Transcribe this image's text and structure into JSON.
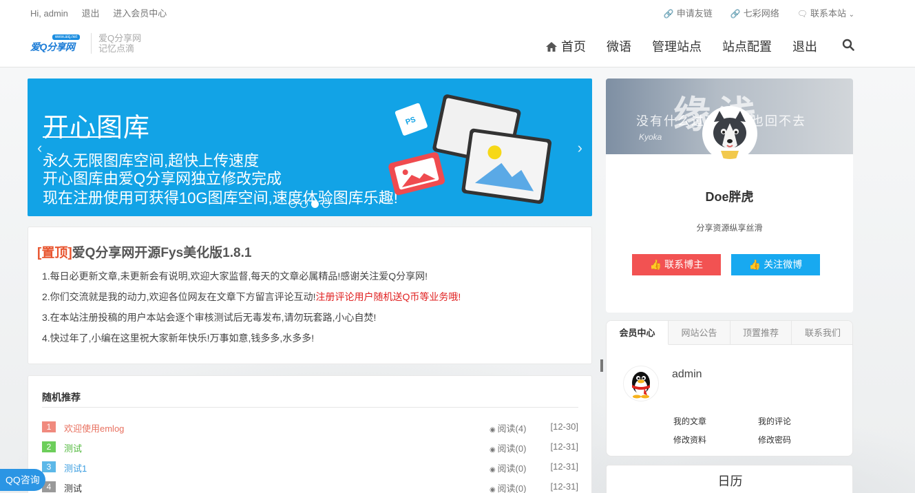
{
  "topbar": {
    "greeting": "Hi, admin",
    "logout": "退出",
    "member_center": "进入会员中心",
    "links": [
      {
        "icon": "link-icon",
        "label": "申请友链"
      },
      {
        "icon": "link-icon",
        "label": "七彩网络"
      },
      {
        "icon": "chat-icon",
        "label": "联系本站"
      }
    ]
  },
  "header": {
    "logo_text": "爱Q分享网",
    "logo_tag": "www.aiq.net",
    "slogan_line1": "爱Q分享网",
    "slogan_line2": "记忆点滴",
    "nav": [
      {
        "label": "首页",
        "icon": "home-icon"
      },
      {
        "label": "微语"
      },
      {
        "label": "管理站点"
      },
      {
        "label": "站点配置"
      },
      {
        "label": "退出"
      }
    ]
  },
  "banner": {
    "title": "开心图库",
    "lines": [
      "永久无限图库空间,超快上传速度",
      "开心图库由爱Q分享网独立修改完成",
      "现在注册使用可获得10G图库空间,速度体验图库乐趣!"
    ],
    "ps_badge": "PS",
    "active_slide": 3,
    "slide_count": 4
  },
  "post": {
    "top_tag": "[置顶]",
    "title": "爱Q分享网开源Fys美化版1.8.1",
    "para1": "1.每日必更新文章,未更新会有说明,欢迎大家监督,每天的文章必属精品!感谢关注爱Q分享网!",
    "para2_black": "2.你们交流就是我的动力,欢迎各位网友在文章下方留言评论互动!",
    "para2_red": "注册评论用户随机送Q币等业务哦!",
    "para3": "3.在本站注册投稿的用户本站会逐个审核测试后无毒发布,请勿玩套路,小心自焚!",
    "para4": "4.快过年了,小编在这里祝大家新年快乐!万事如意,钱多多,水多多!"
  },
  "random": {
    "heading": "随机推荐",
    "items": [
      {
        "num": "1",
        "title": "欢迎使用emlog",
        "views": "阅读(4)",
        "date": "[12-30]",
        "num_color": "#f08a7e",
        "title_color": "#e8705f"
      },
      {
        "num": "2",
        "title": "测试",
        "views": "阅读(0)",
        "date": "[12-31]",
        "num_color": "#6dce5b",
        "title_color": "#4fb83b"
      },
      {
        "num": "3",
        "title": "测试1",
        "views": "阅读(0)",
        "date": "[12-31]",
        "num_color": "#5cb8e8",
        "title_color": "#3a9de0"
      },
      {
        "num": "4",
        "title": "测试",
        "views": "阅读(0)",
        "date": "[12-31]",
        "num_color": "#999999",
        "title_color": "#333333"
      }
    ]
  },
  "profile": {
    "cover_big": "缘浅",
    "cover_small": "没有什么过不去 再也回不去",
    "cover_sig": "Kyoka",
    "name": "Doe胖虎",
    "desc": "分享资源纵享丝滑",
    "btn_contact": "联系博主",
    "btn_follow": "关注微博"
  },
  "tabs": {
    "items": [
      "会员中心",
      "网站公告",
      "顶置推荐",
      "联系我们"
    ],
    "active": 0,
    "username": "admin",
    "links": [
      "我的文章",
      "我的评论",
      "修改资料",
      "修改密码"
    ]
  },
  "calendar": {
    "title": "日历"
  },
  "float": {
    "qq": "QQ咨询"
  }
}
